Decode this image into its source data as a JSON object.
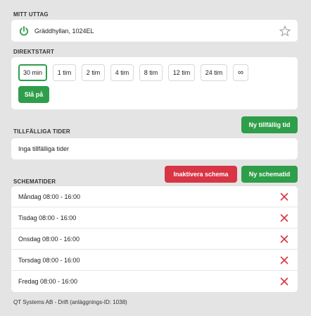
{
  "outlet": {
    "section_label": "MITT UTTAG",
    "name": "Gräddhyllan, 1024EL",
    "power_icon": "power-icon",
    "favorite_icon": "star-icon"
  },
  "direct_start": {
    "section_label": "DIREKTSTART",
    "durations": [
      "30 min",
      "1 tim",
      "2 tim",
      "4 tim",
      "8 tim",
      "12 tim",
      "24 tim",
      "∞"
    ],
    "selected": "30 min",
    "turn_on_label": "Slå på"
  },
  "temporary": {
    "section_label": "TILLFÄLLIGA TIDER",
    "new_button": "Ny tillfällig tid",
    "empty_text": "Inga tillfälliga tider"
  },
  "schedule": {
    "section_label": "SCHEMATIDER",
    "deactivate_button": "Inaktivera schema",
    "new_button": "Ny schematid",
    "items": [
      "Måndag 08:00 - 16:00",
      "Tisdag 08:00 - 16:00",
      "Onsdag 08:00 - 16:00",
      "Torsdag 08:00 - 16:00",
      "Fredag 08:00 - 16:00"
    ]
  },
  "footer": "QT Systems AB - Drift (anläggnings-ID: 1038)",
  "colors": {
    "green": "#2e9e4a",
    "red": "#d83545",
    "background": "#e4e4e4"
  }
}
